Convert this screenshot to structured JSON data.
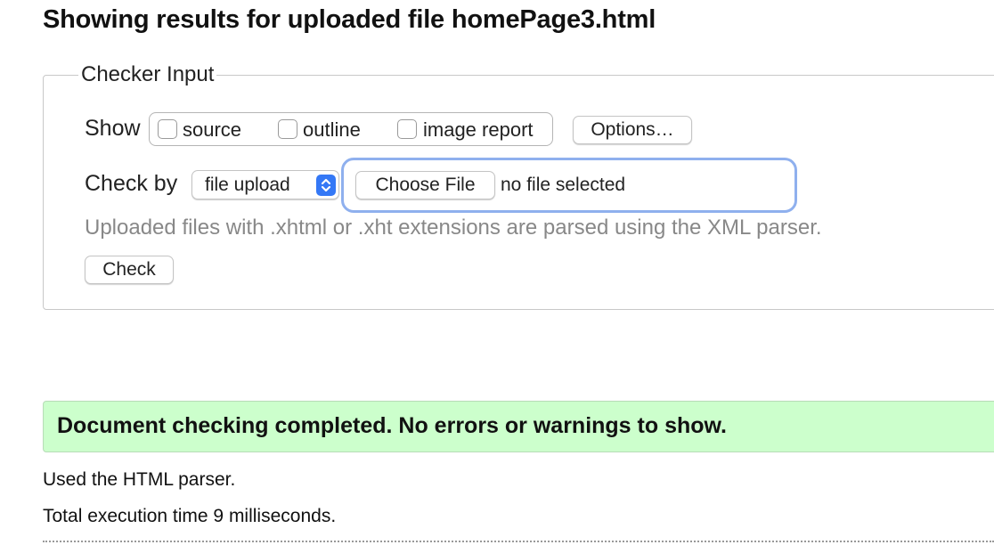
{
  "header": {
    "title": "Showing results for uploaded file homePage3.html"
  },
  "checker_input": {
    "legend": "Checker Input",
    "show_label": "Show",
    "show_options": [
      {
        "label": "source",
        "checked": false
      },
      {
        "label": "outline",
        "checked": false
      },
      {
        "label": "image report",
        "checked": false
      }
    ],
    "options_button": "Options…",
    "check_by_label": "Check by",
    "check_by_select": {
      "selected": "file upload"
    },
    "choose_file_button": "Choose File",
    "file_status": "no file selected",
    "hint": "Uploaded files with .xhtml or .xht extensions are parsed using the XML parser.",
    "check_button": "Check"
  },
  "results": {
    "success_message": "Document checking completed. No errors or warnings to show.",
    "parser_info": "Used the HTML parser.",
    "execution_time": "Total execution time 9 milliseconds."
  },
  "colors": {
    "success_background": "#ccffcc",
    "focus_ring": "#8fb0ee",
    "select_accent": "#3478f6",
    "hint_text": "#888888"
  },
  "icons": {
    "select_arrows": "updown-chevrons-icon"
  }
}
